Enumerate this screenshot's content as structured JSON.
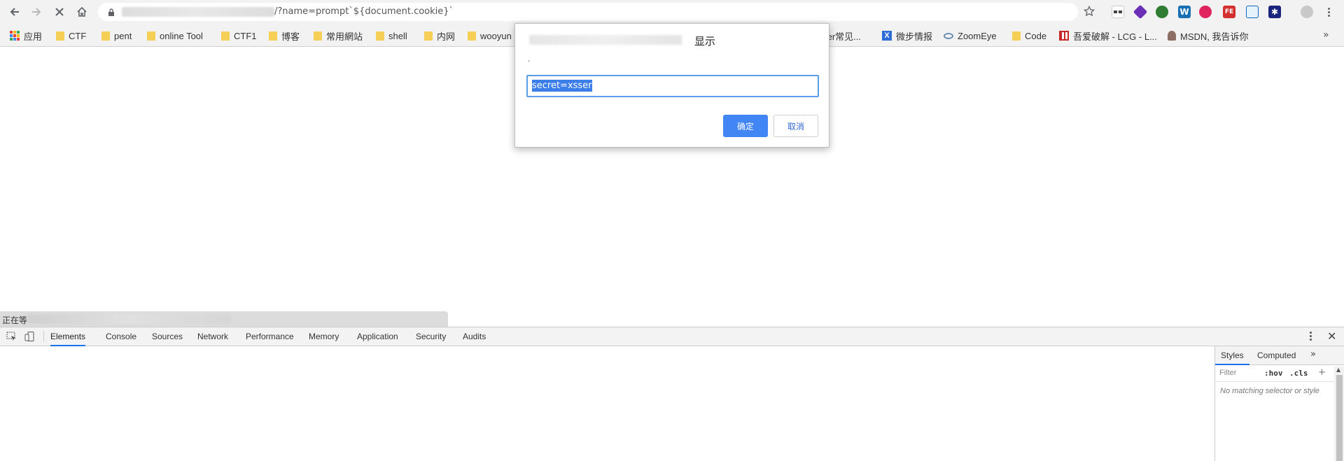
{
  "browser": {
    "url_visible": "/?name=prompt`${document.cookie}`",
    "icons": {
      "back": "back-arrow-icon",
      "forward": "forward-arrow-icon",
      "stop": "stop-loading-icon",
      "home": "home-icon",
      "lock": "lock-icon",
      "star": "bookmark-star-icon"
    },
    "extension_colors": [
      "#444444",
      "#6a2fb5",
      "#2e7d32",
      "#1a6fb3",
      "#e0245e",
      "#d32f2f",
      "#1565c0",
      "#1a237e"
    ]
  },
  "bookmarks": {
    "items": [
      {
        "label": "应用",
        "icon": "apps-icon"
      },
      {
        "label": "CTF",
        "icon": "folder-icon"
      },
      {
        "label": "pent",
        "icon": "folder-icon"
      },
      {
        "label": "online Tool",
        "icon": "folder-icon"
      },
      {
        "label": "CTF1",
        "icon": "folder-icon"
      },
      {
        "label": "博客",
        "icon": "folder-icon"
      },
      {
        "label": "常用網站",
        "icon": "folder-icon"
      },
      {
        "label": "shell",
        "icon": "folder-icon"
      },
      {
        "label": "内网",
        "icon": "folder-icon"
      },
      {
        "label": "wooyun",
        "icon": "folder-icon"
      },
      {
        "label": "ter常见...",
        "icon": "folder-icon"
      },
      {
        "label": "微步情报",
        "icon": "x-logo-icon"
      },
      {
        "label": "ZoomEye",
        "icon": "eye-icon"
      },
      {
        "label": "Code",
        "icon": "folder-icon"
      },
      {
        "label": "吾爱破解 - LCG - L...",
        "icon": "grid-logo-icon"
      },
      {
        "label": "MSDN, 我告诉你",
        "icon": "msdn-icon"
      }
    ],
    "overflow": "»"
  },
  "dialog": {
    "title_suffix": "显示",
    "message": ".",
    "input_value": "secret=xsser",
    "ok_label": "确定",
    "cancel_label": "取消"
  },
  "status": {
    "text": "正在等"
  },
  "devtools": {
    "tabs": [
      "Elements",
      "Console",
      "Sources",
      "Network",
      "Performance",
      "Memory",
      "Application",
      "Security",
      "Audits"
    ],
    "active_tab": "Elements",
    "styles_tabs": [
      "Styles",
      "Computed"
    ],
    "filter_placeholder": "Filter",
    "hov_label": ":hov",
    "cls_label": ".cls",
    "add_rule": "+",
    "empty_message": "No matching selector or style",
    "accent_color": "#1a73e8"
  }
}
